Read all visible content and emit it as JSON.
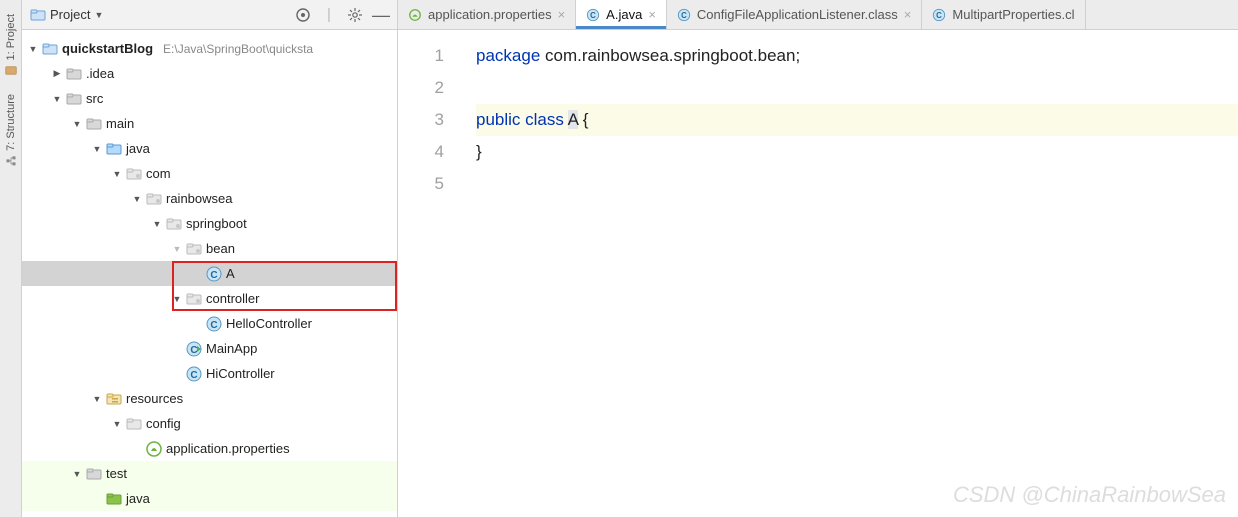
{
  "left_strip": {
    "project": "1: Project",
    "structure": "7: Structure"
  },
  "panel": {
    "title": "Project",
    "actions": {
      "target": "target",
      "divider": "divider",
      "gear": "gear",
      "minimize": "minimize"
    }
  },
  "tree": {
    "root": {
      "name": "quickstartBlog",
      "path": "E:\\Java\\SpringBoot\\quicksta"
    },
    "idea": ".idea",
    "src": "src",
    "main": "main",
    "java": "java",
    "com": "com",
    "rainbowsea": "rainbowsea",
    "springboot": "springboot",
    "bean": "bean",
    "class_A": "A",
    "controller": "controller",
    "HelloController": "HelloController",
    "MainApp": "MainApp",
    "HiController": "HiController",
    "resources": "resources",
    "config": "config",
    "app_props": "application.properties",
    "test": "test",
    "test_java": "java"
  },
  "tabs": [
    {
      "label": "application.properties",
      "kind": "props"
    },
    {
      "label": "A.java",
      "kind": "class",
      "active": true
    },
    {
      "label": "ConfigFileApplicationListener.class",
      "kind": "class"
    },
    {
      "label": "MultipartProperties.cl",
      "kind": "class"
    }
  ],
  "code": {
    "lines": [
      "1",
      "2",
      "3",
      "4",
      "5"
    ],
    "l1_kw": "package",
    "l1_rest": " com.rainbowsea.springboot.bean;",
    "l3_kw": "public class ",
    "l3_name": "A",
    "l3_rest": " {",
    "l4": "}"
  },
  "watermark": "CSDN @ChinaRainbowSea"
}
